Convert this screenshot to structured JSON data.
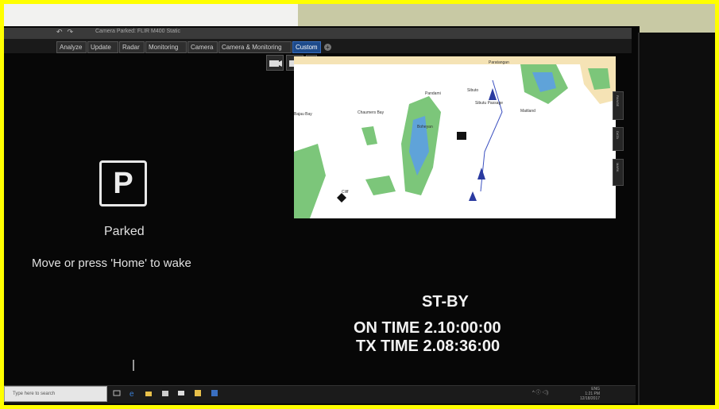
{
  "window": {
    "title": "Camera Parked: FLIR M400 Static",
    "app_logo": "eo"
  },
  "tabs": [
    {
      "label": "Analyze"
    },
    {
      "label": "Update"
    },
    {
      "label": "Radar"
    },
    {
      "label": "Monitoring"
    },
    {
      "label": "Camera"
    },
    {
      "label": "Camera & Monitoring"
    },
    {
      "label": "Custom",
      "active": true
    }
  ],
  "tab_add_label": "+",
  "camera_panel": {
    "icon_letter": "P",
    "status": "Parked",
    "message": "Move or press 'Home' to wake"
  },
  "chart_panel": {
    "labels": [
      "Cliff",
      "Sibuto",
      "Sibutu Passage",
      "Pandami",
      "Bajau Bay",
      "Chaumers Bay",
      "Boheyan",
      "Maitland",
      "Paratangan"
    ],
    "side_buttons": [
      "RANGE",
      "DATA",
      "MARK"
    ]
  },
  "radar_status": {
    "mode": "ST-BY",
    "on_time": "ON TIME 2.10:00:00",
    "tx_time": "TX TIME 2.08:36:00"
  },
  "taskbar": {
    "search_placeholder": "Type here to search",
    "tray_text": "^ ⓘ ◁)",
    "lang": "ENG",
    "time": "1:21 PM",
    "date": "12/18/2017"
  },
  "colors": {
    "accent_tab": "#1d4a8a",
    "border": "#ffff00",
    "land": "#f5e3b5",
    "shoal": "#7cc67a",
    "deep_water": "#5fa3d9"
  }
}
